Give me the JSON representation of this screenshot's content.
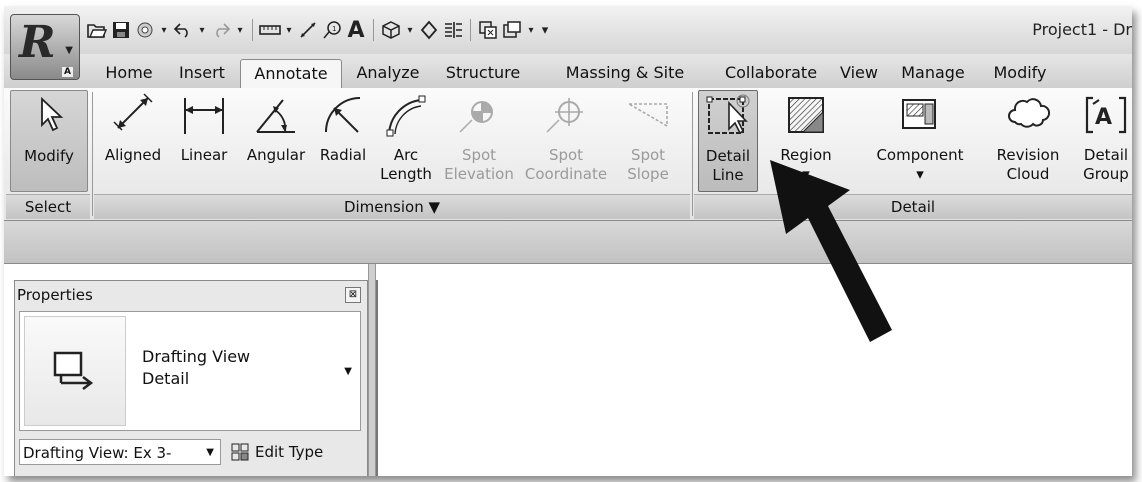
{
  "app": {
    "title": "Project1 - Dr",
    "logo_letter": "R",
    "logo_key": "A"
  },
  "quick_access": [
    "open-icon",
    "save-icon",
    "sync-icon",
    "undo-icon",
    "redo-icon",
    "measure-icon",
    "aligned-dim-icon",
    "tag-icon",
    "text-icon",
    "3d-view-icon",
    "section-icon",
    "thin-lines-icon",
    "close-hidden-icon",
    "switch-windows-icon",
    "customize-icon"
  ],
  "tabs": [
    "Home",
    "Insert",
    "Annotate",
    "Analyze",
    "Structure",
    "Massing & Site",
    "Collaborate",
    "View",
    "Manage",
    "Modify"
  ],
  "active_tab": "Annotate",
  "ribbon": {
    "select_panel": {
      "button": "Modify",
      "label": "Select"
    },
    "dimension_panel": {
      "label": "Dimension ▼",
      "buttons": [
        {
          "line1": "Aligned",
          "line2": ""
        },
        {
          "line1": "Linear",
          "line2": ""
        },
        {
          "line1": "Angular",
          "line2": ""
        },
        {
          "line1": "Radial",
          "line2": ""
        },
        {
          "line1": "Arc",
          "line2": "Length"
        },
        {
          "line1": "Spot",
          "line2": "Elevation"
        },
        {
          "line1": "Spot",
          "line2": "Coordinate"
        },
        {
          "line1": "Spot",
          "line2": "Slope"
        }
      ]
    },
    "detail_panel": {
      "label": "Detail",
      "buttons": [
        {
          "line1": "Detail",
          "line2": "Line"
        },
        {
          "line1": "Region",
          "line2": "▾"
        },
        {
          "line1": "Component",
          "line2": "▾"
        },
        {
          "line1": "Revision",
          "line2": "Cloud"
        },
        {
          "line1": "Detail",
          "line2": "Group"
        }
      ]
    }
  },
  "properties": {
    "title": "Properties",
    "close": "⊠",
    "type_line1": "Drafting View",
    "type_line2": "Detail",
    "instance_dropdown": "Drafting View: Ex 3-",
    "edit_type": "Edit Type"
  }
}
